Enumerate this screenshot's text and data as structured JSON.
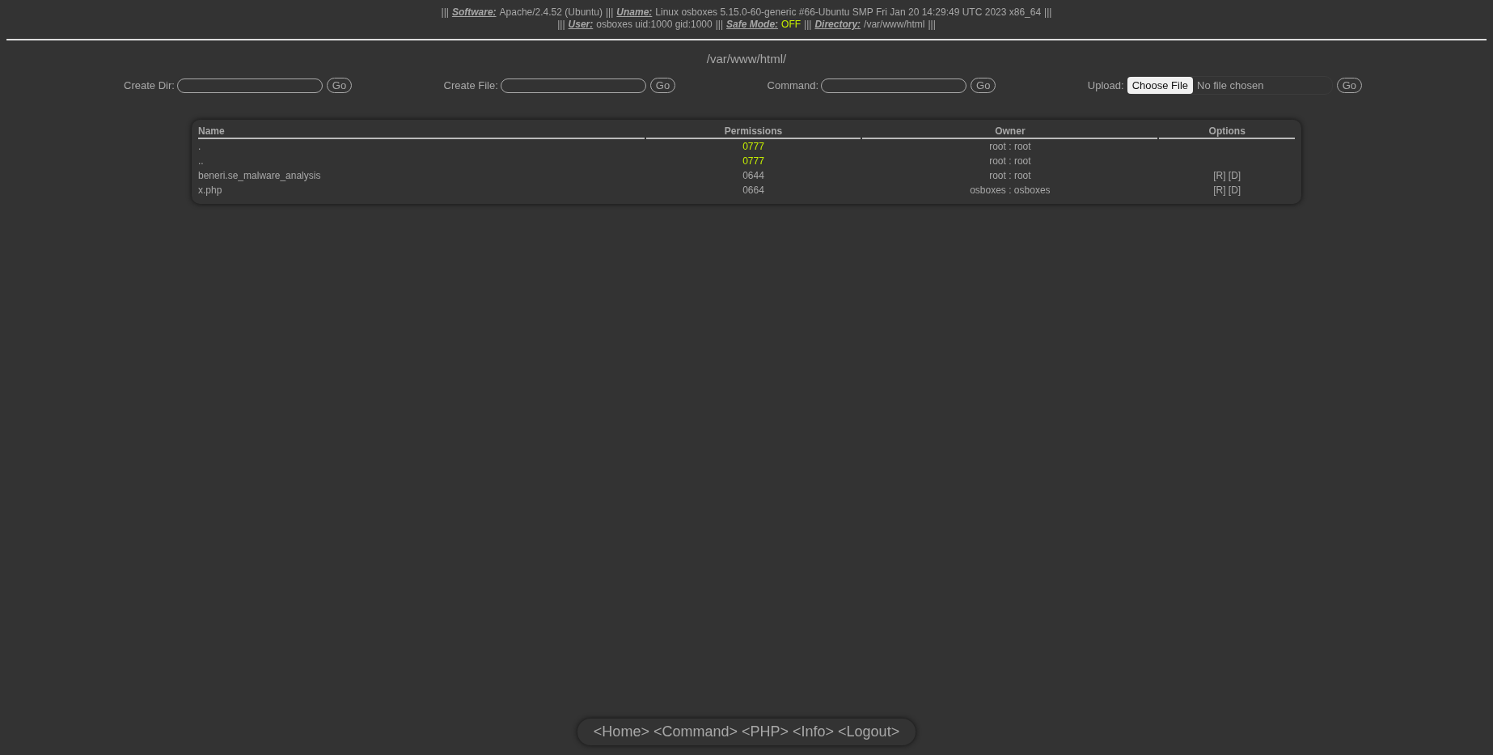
{
  "info_lines": [
    {
      "items": [
        {
          "kind": "sep",
          "text": "|||"
        },
        {
          "kind": "label",
          "text": "Software:"
        },
        {
          "kind": "value",
          "text": "Apache/2.4.52 (Ubuntu)"
        },
        {
          "kind": "sep",
          "text": "|||"
        },
        {
          "kind": "label",
          "text": "Uname:"
        },
        {
          "kind": "value",
          "text": "Linux osboxes 5.15.0-60-generic #66-Ubuntu SMP Fri Jan 20 14:29:49 UTC 2023 x86_64"
        },
        {
          "kind": "sep",
          "text": "|||"
        }
      ]
    },
    {
      "items": [
        {
          "kind": "sep",
          "text": "|||"
        },
        {
          "kind": "label",
          "text": "User:"
        },
        {
          "kind": "value",
          "text": "osboxes uid:1000 gid:1000"
        },
        {
          "kind": "sep",
          "text": "|||"
        },
        {
          "kind": "label",
          "text": "Safe Mode:"
        },
        {
          "kind": "status",
          "text": "OFF"
        },
        {
          "kind": "sep",
          "text": "|||"
        },
        {
          "kind": "label",
          "text": "Directory:"
        },
        {
          "kind": "value",
          "text": "/var/www/html"
        },
        {
          "kind": "sep",
          "text": "|||"
        }
      ]
    }
  ],
  "current_path": "/var/www/html/",
  "forms": [
    {
      "kind": "text",
      "label": "Create Dir:",
      "button": "Go"
    },
    {
      "kind": "text",
      "label": "Create File:",
      "button": "Go"
    },
    {
      "kind": "text",
      "label": "Command:",
      "button": "Go"
    },
    {
      "kind": "file",
      "label": "Upload:",
      "chooser": "Choose File",
      "status": "No file chosen",
      "button": "Go"
    }
  ],
  "table": {
    "columns": [
      "Name",
      "Permissions",
      "Owner",
      "Options"
    ],
    "rows": [
      {
        "name": ".",
        "permissions": "0777",
        "writable": true,
        "owner": "root : root",
        "options": ""
      },
      {
        "name": "..",
        "permissions": "0777",
        "writable": true,
        "owner": "root : root",
        "options": ""
      },
      {
        "name": "beneri.se_malware_analysis",
        "permissions": "0644",
        "writable": false,
        "owner": "root : root",
        "options": "[R] [D]"
      },
      {
        "name": "x.php",
        "permissions": "0664",
        "writable": false,
        "owner": "osboxes : osboxes",
        "options": "[R] [D]"
      }
    ]
  },
  "footer_links": [
    "<Home>",
    "<Command>",
    "<PHP>",
    "<Info>",
    "<Logout>"
  ]
}
